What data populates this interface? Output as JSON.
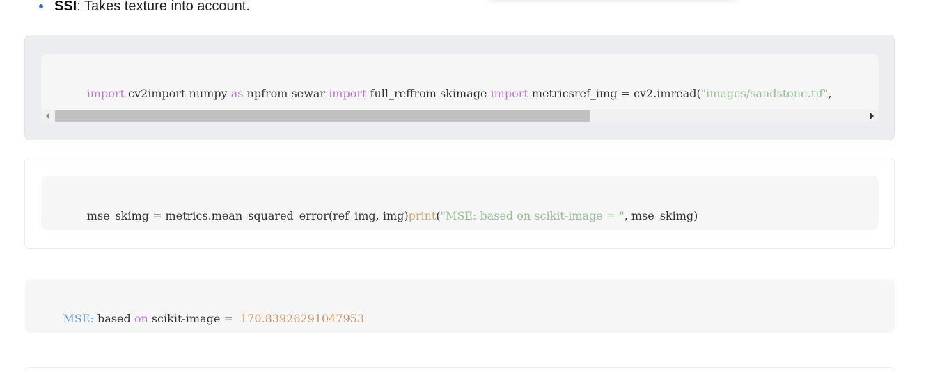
{
  "bullet": {
    "term": "SSI",
    "description": ": Takes texture into account."
  },
  "code_block_1": {
    "tokens": [
      {
        "text": "import",
        "style": "kw"
      },
      {
        "text": " cv2import numpy ",
        "style": "plain"
      },
      {
        "text": "as",
        "style": "kw"
      },
      {
        "text": " npfrom sewar ",
        "style": "plain"
      },
      {
        "text": "import",
        "style": "kw"
      },
      {
        "text": " full_reffrom skimage ",
        "style": "plain"
      },
      {
        "text": "import",
        "style": "kw"
      },
      {
        "text": " metricsref_img = cv2.imread(",
        "style": "plain"
      },
      {
        "text": "\"images/sandstone.tif\"",
        "style": "str"
      },
      {
        "text": ",",
        "style": "plain"
      }
    ],
    "scrollbar_progress": 0.66
  },
  "code_block_2": {
    "tokens": [
      {
        "text": "mse_skimg = metrics.mean_squared_error(ref_img, img)",
        "style": "plain"
      },
      {
        "text": "print",
        "style": "fn"
      },
      {
        "text": "(",
        "style": "plain"
      },
      {
        "text": "\"MSE: based on scikit-image = \"",
        "style": "str"
      },
      {
        "text": ", mse_skimg)",
        "style": "plain"
      }
    ]
  },
  "output_block": {
    "tokens": [
      {
        "text": "MSE:",
        "style": "lbl"
      },
      {
        "text": " based ",
        "style": "plain"
      },
      {
        "text": "on",
        "style": "kw"
      },
      {
        "text": " scikit-image = ",
        "style": "plain"
      },
      {
        "text": " 170.83926291047953",
        "style": "num"
      }
    ]
  }
}
